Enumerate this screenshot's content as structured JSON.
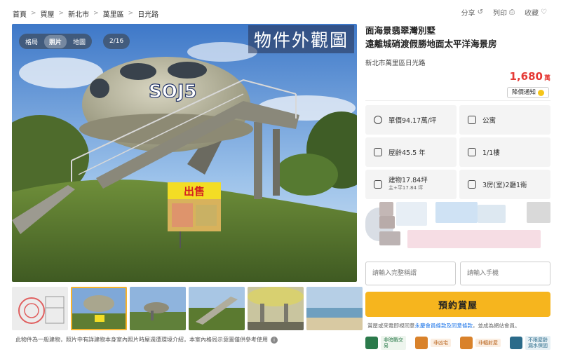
{
  "breadcrumb": [
    "首頁",
    "買屋",
    "新北市",
    "萬里區",
    "日光路"
  ],
  "actions": {
    "share": "分享",
    "print": "列印",
    "favorite": "收藏"
  },
  "gallery": {
    "tabs": [
      "格局",
      "照片",
      "地圖"
    ],
    "active_tab": "照片",
    "counter": "2/16",
    "overlay_title": "物件外觀圖",
    "sale_sign": "出售",
    "disclaimer": "此物件為一般建物，照片中有詳建物本身室內照片時屋週遭環境介紹，本室內格局示意圖僅供參考使用"
  },
  "listing": {
    "title_line1": "面海景翡翠灣別墅",
    "title_line2": "遠離城硝渡假勝地面太平洋海景房",
    "address": "新北市萬里區日光路",
    "price": "1,680",
    "price_unit": "萬",
    "notify_label": "降價通知"
  },
  "specs": [
    {
      "icon": "dollar-icon",
      "label": "單價94.17萬/坪"
    },
    {
      "icon": "building-icon",
      "label": "公寓"
    },
    {
      "icon": "calendar-icon",
      "label": "屋齡45.5 年"
    },
    {
      "icon": "floor-icon",
      "label": "1/1樓"
    },
    {
      "icon": "area-icon",
      "label": "建物17.84坪",
      "sub": "主+平17.84 坪"
    },
    {
      "icon": "layout-icon",
      "label": "3房(室)2廳1衛"
    }
  ],
  "form": {
    "name_placeholder": "請輸入完整稱謂",
    "phone_placeholder": "請輸入手機",
    "submit": "預約賞屋",
    "consent_prefix": "賞屋或來電即視同意",
    "consent_link": "永慶會員條款及同意條款",
    "consent_suffix": "，並成為網站會員。"
  },
  "badges": [
    "非暗戰交易",
    "非凶宅",
    "非輻射屋",
    "不限屋齡漏水保固"
  ],
  "colors": {
    "accent": "#f6b51e",
    "price": "#e53935",
    "badge_green": "#2b7a4b",
    "badge_orange": "#d9822b"
  }
}
